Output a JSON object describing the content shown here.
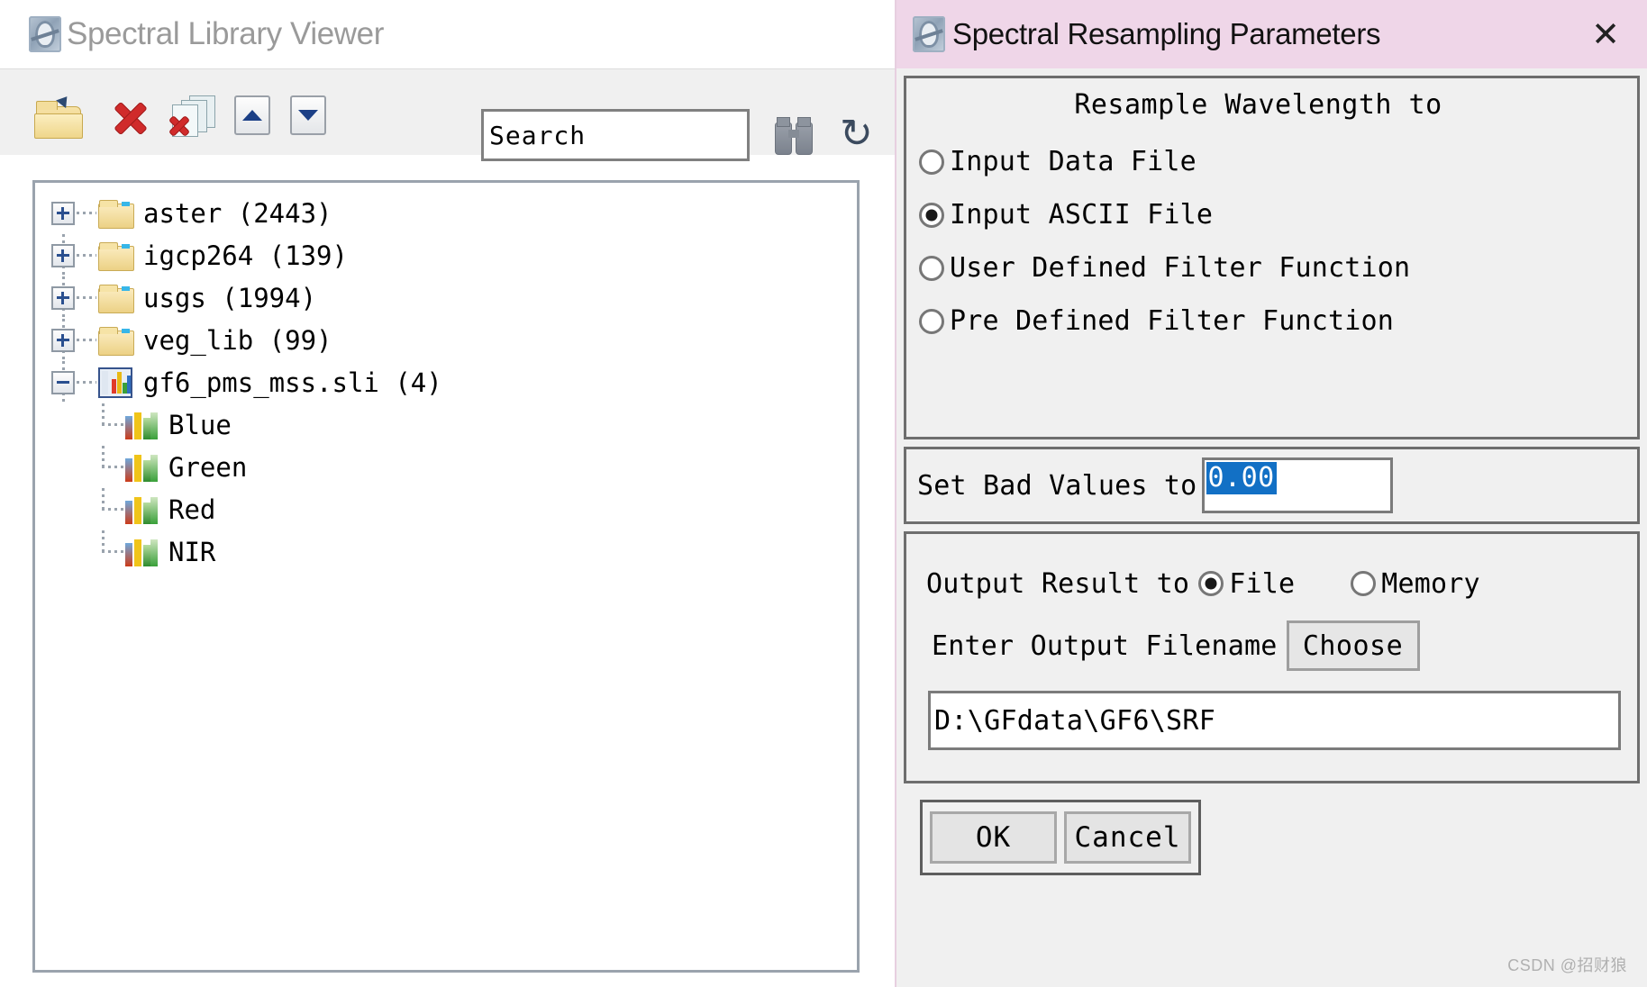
{
  "viewer": {
    "title": "Spectral Library Viewer",
    "app_icon": "spectral-globe-icon",
    "toolbar": {
      "open_label": "open-folder-icon",
      "delete_label": "delete-icon",
      "delete_all_label": "delete-all-icon",
      "move_up_label": "move-up-icon",
      "move_down_label": "move-down-icon",
      "find_label": "binoculars-icon",
      "refresh_label": "refresh-icon"
    },
    "search": {
      "value": "Search",
      "placeholder": "Search"
    },
    "tree": [
      {
        "label": "aster",
        "count": "(2443)",
        "icon": "folder-icon",
        "state": "collapsed",
        "level": 0
      },
      {
        "label": "igcp264",
        "count": "(139)",
        "icon": "folder-icon",
        "state": "collapsed",
        "level": 0
      },
      {
        "label": "usgs",
        "count": "(1994)",
        "icon": "folder-icon",
        "state": "collapsed",
        "level": 0
      },
      {
        "label": "veg_lib",
        "count": "(99)",
        "icon": "folder-icon",
        "state": "collapsed",
        "level": 0
      },
      {
        "label": "gf6_pms_mss.sli",
        "count": "(4)",
        "icon": "spectral-library-icon",
        "state": "expanded",
        "level": 0
      },
      {
        "label": "Blue",
        "count": "",
        "icon": "spectrum-icon",
        "state": "leaf",
        "level": 1
      },
      {
        "label": "Green",
        "count": "",
        "icon": "spectrum-icon",
        "state": "leaf",
        "level": 1
      },
      {
        "label": "Red",
        "count": "",
        "icon": "spectrum-icon",
        "state": "leaf",
        "level": 1
      },
      {
        "label": "NIR",
        "count": "",
        "icon": "spectrum-icon",
        "state": "leaf",
        "level": 1
      }
    ]
  },
  "dialog": {
    "title": "Spectral Resampling Parameters",
    "close_label": "✕",
    "titlebar_color": "#efd6e8",
    "resample": {
      "header": "Resample Wavelength to",
      "options": [
        {
          "label": "Input Data File",
          "checked": false
        },
        {
          "label": "Input ASCII File",
          "checked": true
        },
        {
          "label": "User Defined Filter Function",
          "checked": false
        },
        {
          "label": "Pre Defined Filter Function",
          "checked": false
        }
      ]
    },
    "bad_values": {
      "label": "Set Bad Values to",
      "value": "0.00",
      "selected": true,
      "selection_color": "#1270c5"
    },
    "output": {
      "label": "Output Result to",
      "options": [
        {
          "label": "File",
          "checked": true
        },
        {
          "label": "Memory",
          "checked": false
        }
      ],
      "filename_label": "Enter Output Filename",
      "choose_label": "Choose",
      "filename_value": "D:\\GFdata\\GF6\\SRF"
    },
    "buttons": {
      "ok": "OK",
      "cancel": "Cancel"
    }
  },
  "watermark": "CSDN @招财狼"
}
